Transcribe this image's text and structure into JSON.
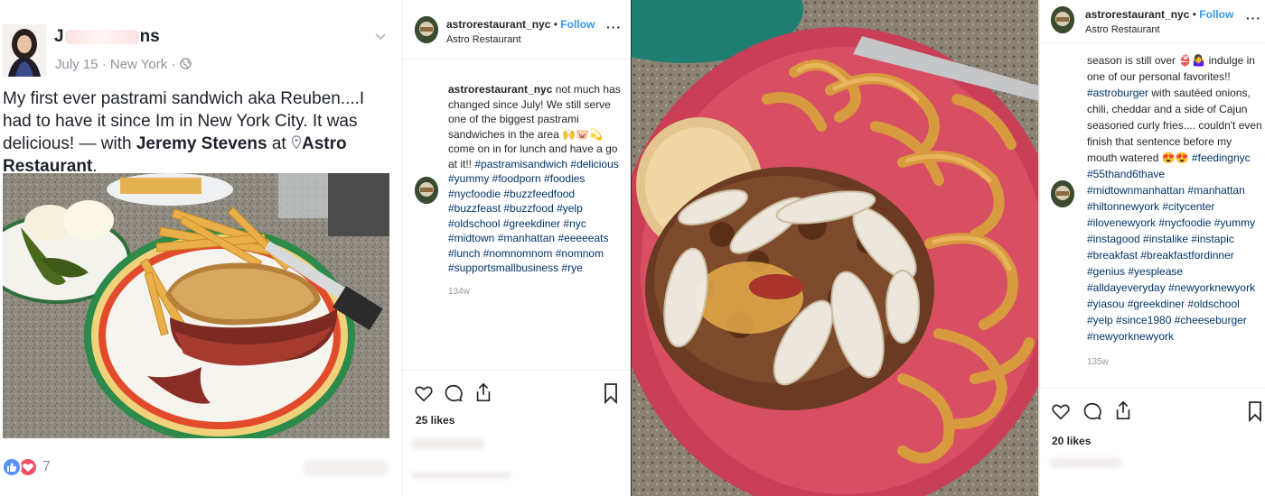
{
  "facebook_post": {
    "name_start": "J",
    "name_end": "ns",
    "date": "July 15",
    "location": "New York",
    "text_main": "My first ever pastrami sandwich aka Reuben....I had to have it since Im in New York City. It was delicious! — with ",
    "tagged_person": "Jeremy Stevens",
    "at_word": " at ",
    "tagged_place": "Astro Restaurant",
    "period": ".",
    "reaction_count": "7",
    "colors": {
      "like": "#5890ff",
      "love": "#f25268",
      "meta": "#90949c"
    }
  },
  "ig_post_1": {
    "username": "astrorestaurant_nyc",
    "follow_label": "Follow",
    "location": "Astro Restaurant",
    "caption_user": "astrorestaurant_nyc",
    "caption_text": " not much has changed since July! We still serve one of the biggest pastrami sandwiches in the area 🙌🐷💫 come on in for lunch and have a go at it!! ",
    "hashtags": "#pastramisandwich #delicious #yummy #foodporn #foodies #nycfoodie #buzzfeedfood #buzzfeast #buzzfood #yelp #oldschool #greekdiner #nyc #midtown #manhattan #eeeeeats #lunch #nomnomnom #nomnom #supportsmallbusiness #rye",
    "time": "134w",
    "likes": "25 likes"
  },
  "ig_post_2": {
    "username": "astrorestaurant_nyc",
    "follow_label": "Follow",
    "location": "Astro Restaurant",
    "caption_text": "season is still over 👙🤷‍♀️ indulge in one of our personal favorites!! ",
    "tag_burger": "#astroburger",
    "caption_text_2": " with sautéed onions, chili, cheddar and a side of Cajun seasoned curly fries.... couldn't even finish that sentence before my mouth watered 😍😍 ",
    "hashtags_a": "#feedingnyc #55thand6thave",
    "hashtags_b": "#midtownmanhattan #manhattan #hiltonnewyork #citycenter #ilovenewyork #nycfoodie #yummy #instagood #instalike #instapic #breakfast #breakfastfordinner #genius #yesplease #alldayeveryday #newyorknewyork #yiasou #greekdiner #oldschool #yelp #since1980 #cheeseburger #newyorknewyork",
    "time": "135w",
    "likes": "20 likes"
  },
  "icons": [
    "heart-icon",
    "comment-icon",
    "share-icon",
    "bookmark-icon",
    "more-icon",
    "globe-icon",
    "location-pin-icon",
    "chevron-down-icon"
  ]
}
